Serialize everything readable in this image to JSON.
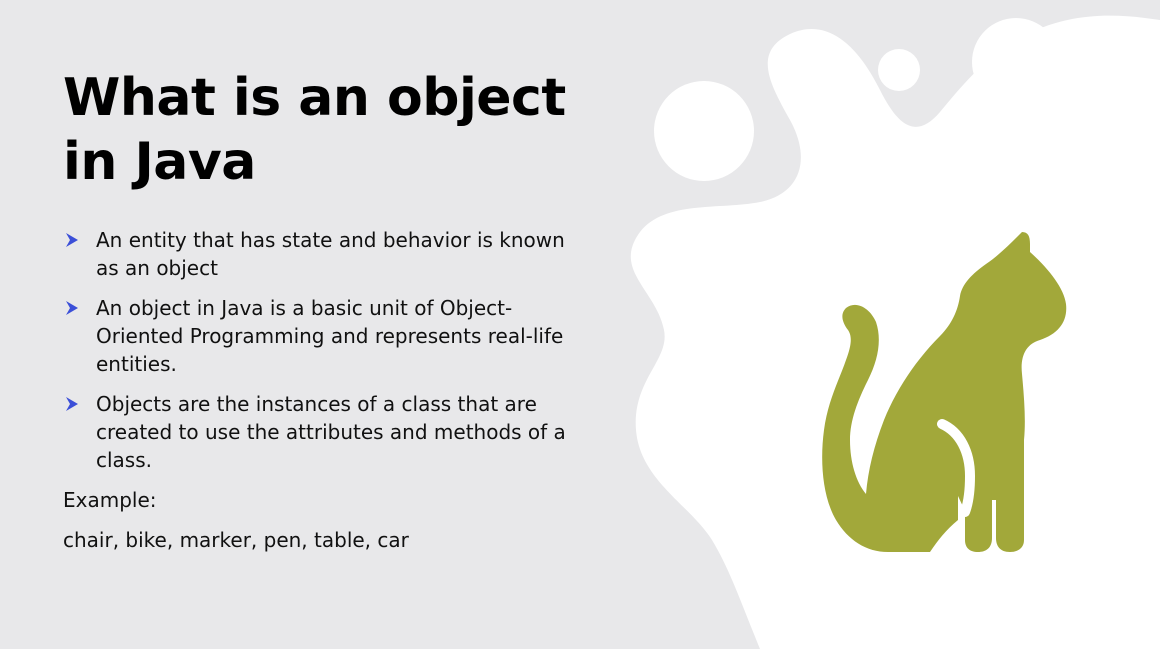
{
  "slide": {
    "title": "What is an object in Java",
    "bullets": [
      " An entity that has state and behavior is known as an object",
      "An object in Java is a basic unit of Object-Oriented Programming and represents real-life entities.",
      "Objects are the instances of a class that are created to use the attributes and methods of a class."
    ],
    "example_label": "Example:",
    "example_values": "chair, bike, marker, pen, table, car"
  },
  "icons": {
    "bullet": "arrow-bullet-icon",
    "illustration": "cat-icon"
  },
  "colors": {
    "background": "#e8e8ea",
    "blob": "#ffffff",
    "bullet_arrow": "#3b4fd8",
    "cat": "#a2a83a",
    "text": "#111111"
  }
}
